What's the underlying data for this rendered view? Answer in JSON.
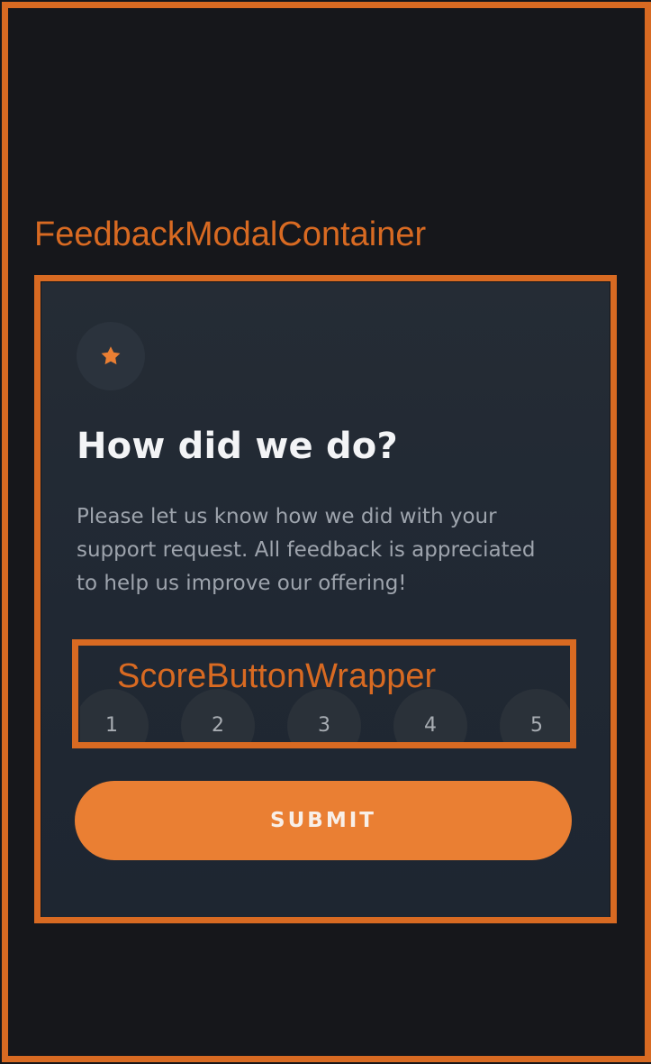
{
  "annotations": {
    "container_label": "FeedbackModalContainer",
    "score_wrapper_label": "ScoreButtonWrapper"
  },
  "modal": {
    "icon_name": "star-icon",
    "icon_color": "#ea7f33",
    "title": "How did we do?",
    "description": "Please let us know how we did with your\nsupport request. All feedback is appreciated\nto help us improve our offering!",
    "scores": [
      "1",
      "2",
      "3",
      "4",
      "5"
    ],
    "submit_label": "SUBMIT"
  },
  "colors": {
    "accent": "#ea7f33",
    "annotation": "#d86a22",
    "background": "#16171b",
    "modal_background": "#222a34"
  }
}
